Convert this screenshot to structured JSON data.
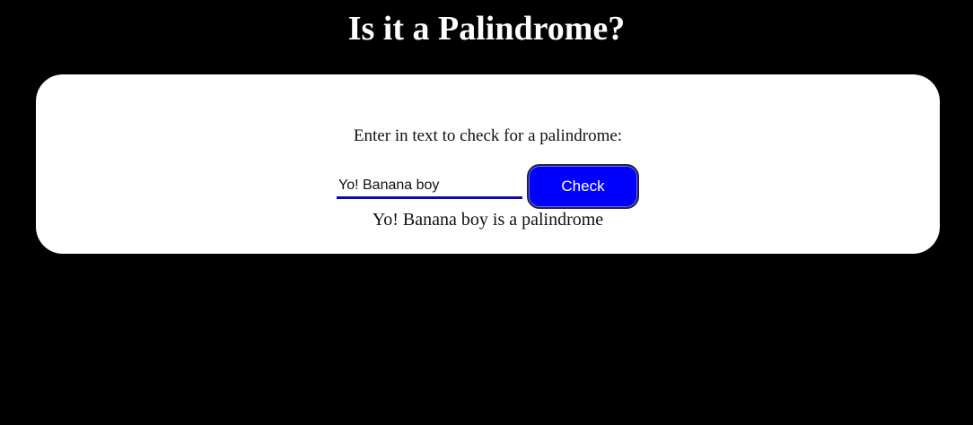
{
  "header": {
    "title": "Is it a Palindrome?"
  },
  "form": {
    "prompt": "Enter in text to check for a palindrome:",
    "input_value": "Yo! Banana boy",
    "button_label": "Check",
    "result_text": "Yo! Banana boy is a palindrome"
  },
  "colors": {
    "background": "#000000",
    "card": "#ffffff",
    "button": "#0000ff",
    "input_underline": "#0b0baa"
  }
}
